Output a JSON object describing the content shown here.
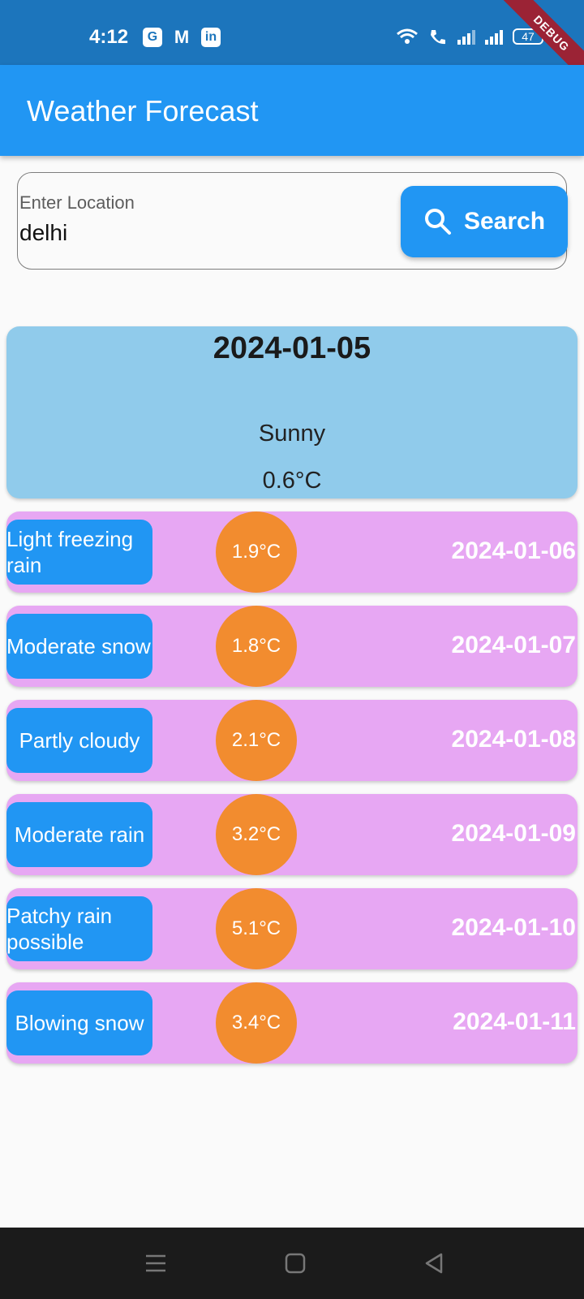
{
  "status_bar": {
    "time": "4:12",
    "battery": "47",
    "debug_ribbon": "DEBUG",
    "left_icons": [
      "google-icon",
      "gmail-icon",
      "linkedin-icon"
    ],
    "right_icons": [
      "wifi-icon",
      "volte-call-icon",
      "signal-icon",
      "signal-icon",
      "battery-icon"
    ]
  },
  "app_bar": {
    "title": "Weather Forecast"
  },
  "search": {
    "label": "Enter Location",
    "value": "delhi",
    "button_label": "Search"
  },
  "today": {
    "date": "2024-01-05",
    "condition": "Sunny",
    "temperature": "0.6°C"
  },
  "forecast": [
    {
      "condition": "Light freezing rain",
      "temperature": "1.9°C",
      "date": "2024-01-06"
    },
    {
      "condition": "Moderate snow",
      "temperature": "1.8°C",
      "date": "2024-01-07"
    },
    {
      "condition": "Partly cloudy",
      "temperature": "2.1°C",
      "date": "2024-01-08"
    },
    {
      "condition": "Moderate rain",
      "temperature": "3.2°C",
      "date": "2024-01-09"
    },
    {
      "condition": "Patchy rain possible",
      "temperature": "5.1°C",
      "date": "2024-01-10"
    },
    {
      "condition": "Blowing snow",
      "temperature": "3.4°C",
      "date": "2024-01-11"
    }
  ],
  "colors": {
    "primary": "#2196f3",
    "today_card": "#90cbeb",
    "forecast_row": "#e7a7f3",
    "temp_circle": "#f28c2f"
  }
}
